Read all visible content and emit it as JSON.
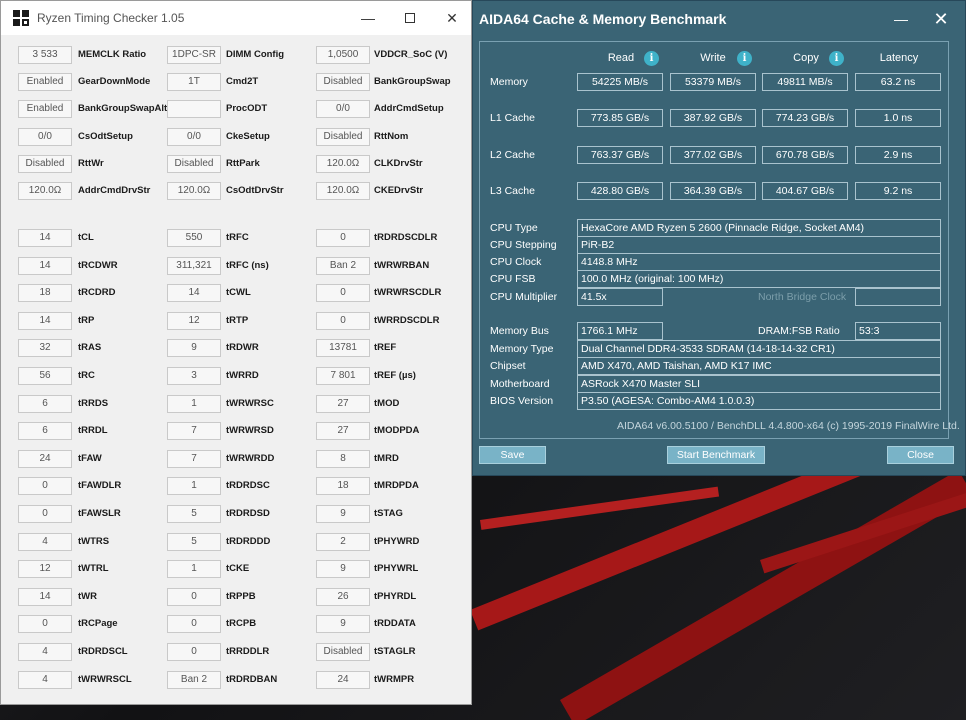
{
  "rtc": {
    "title": "Ryzen Timing Checker 1.05",
    "minimize": "—",
    "close": "✕",
    "cells": [
      {
        "label": "MEMCLK Ratio",
        "value": "3 533"
      },
      {
        "label": "DIMM Config",
        "value": "1DPC-SR"
      },
      {
        "label": "VDDCR_SoC (V)",
        "value": "1,0500"
      },
      {
        "label": "GearDownMode",
        "value": "Enabled"
      },
      {
        "label": "Cmd2T",
        "value": "1T"
      },
      {
        "label": "BankGroupSwap",
        "value": "Disabled"
      },
      {
        "label": "BankGroupSwapAlt",
        "value": "Enabled"
      },
      {
        "label": "ProcODT",
        "value": ""
      },
      {
        "label": "AddrCmdSetup",
        "value": "0/0"
      },
      {
        "label": "CsOdtSetup",
        "value": "0/0"
      },
      {
        "label": "CkeSetup",
        "value": "0/0"
      },
      {
        "label": "RttNom",
        "value": "Disabled"
      },
      {
        "label": "RttWr",
        "value": "Disabled"
      },
      {
        "label": "RttPark",
        "value": "Disabled"
      },
      {
        "label": "CLKDrvStr",
        "value": "120.0Ω"
      },
      {
        "label": "AddrCmdDrvStr",
        "value": "120.0Ω"
      },
      {
        "label": "CsOdtDrvStr",
        "value": "120.0Ω"
      },
      {
        "label": "CKEDrvStr",
        "value": "120.0Ω"
      },
      {
        "label": "tCL",
        "value": "14"
      },
      {
        "label": "tRFC",
        "value": "550"
      },
      {
        "label": "tRDRDSCDLR",
        "value": "0"
      },
      {
        "label": "tRCDWR",
        "value": "14"
      },
      {
        "label": "tRFC (ns)",
        "value": "311,321"
      },
      {
        "label": "tWRWRBAN",
        "value": "Ban 2"
      },
      {
        "label": "tRCDRD",
        "value": "18"
      },
      {
        "label": "tCWL",
        "value": "14"
      },
      {
        "label": "tWRWRSCDLR",
        "value": "0"
      },
      {
        "label": "tRP",
        "value": "14"
      },
      {
        "label": "tRTP",
        "value": "12"
      },
      {
        "label": "tWRRDSCDLR",
        "value": "0"
      },
      {
        "label": "tRAS",
        "value": "32"
      },
      {
        "label": "tRDWR",
        "value": "9"
      },
      {
        "label": "tREF",
        "value": "13781"
      },
      {
        "label": "tRC",
        "value": "56"
      },
      {
        "label": "tWRRD",
        "value": "3"
      },
      {
        "label": "tREF (µs)",
        "value": "7 801"
      },
      {
        "label": "tRRDS",
        "value": "6"
      },
      {
        "label": "tWRWRSC",
        "value": "1"
      },
      {
        "label": "tMOD",
        "value": "27"
      },
      {
        "label": "tRRDL",
        "value": "6"
      },
      {
        "label": "tWRWRSD",
        "value": "7"
      },
      {
        "label": "tMODPDA",
        "value": "27"
      },
      {
        "label": "tFAW",
        "value": "24"
      },
      {
        "label": "tWRWRDD",
        "value": "7"
      },
      {
        "label": "tMRD",
        "value": "8"
      },
      {
        "label": "tFAWDLR",
        "value": "0"
      },
      {
        "label": "tRDRDSC",
        "value": "1"
      },
      {
        "label": "tMRDPDA",
        "value": "18"
      },
      {
        "label": "tFAWSLR",
        "value": "0"
      },
      {
        "label": "tRDRDSD",
        "value": "5"
      },
      {
        "label": "tSTAG",
        "value": "9"
      },
      {
        "label": "tWTRS",
        "value": "4"
      },
      {
        "label": "tRDRDDD",
        "value": "5"
      },
      {
        "label": "tPHYWRD",
        "value": "2"
      },
      {
        "label": "tWTRL",
        "value": "12"
      },
      {
        "label": "tCKE",
        "value": "1"
      },
      {
        "label": "tPHYWRL",
        "value": "9"
      },
      {
        "label": "tWR",
        "value": "14"
      },
      {
        "label": "tRPPB",
        "value": "0"
      },
      {
        "label": "tPHYRDL",
        "value": "26"
      },
      {
        "label": "tRCPage",
        "value": "0"
      },
      {
        "label": "tRCPB",
        "value": "0"
      },
      {
        "label": "tRDDATA",
        "value": "9"
      },
      {
        "label": "tRDRDSCL",
        "value": "4"
      },
      {
        "label": "tRRDDLR",
        "value": "0"
      },
      {
        "label": "tSTAGLR",
        "value": "Disabled"
      },
      {
        "label": "tWRWRSCL",
        "value": "4"
      },
      {
        "label": "tRDRDBAN",
        "value": "Ban 2"
      },
      {
        "label": "tWRMPR",
        "value": "24"
      }
    ]
  },
  "aida": {
    "title": "AIDA64 Cache & Memory Benchmark",
    "minimize": "—",
    "close": "✕",
    "info_glyph": "i",
    "columns": [
      "Read",
      "Write",
      "Copy",
      "Latency"
    ],
    "bench_rows": [
      {
        "label": "Memory",
        "read": "54225 MB/s",
        "write": "53379 MB/s",
        "copy": "49811 MB/s",
        "latency": "63.2 ns"
      },
      {
        "label": "L1 Cache",
        "read": "773.85 GB/s",
        "write": "387.92 GB/s",
        "copy": "774.23 GB/s",
        "latency": "1.0 ns"
      },
      {
        "label": "L2 Cache",
        "read": "763.37 GB/s",
        "write": "377.02 GB/s",
        "copy": "670.78 GB/s",
        "latency": "2.9 ns"
      },
      {
        "label": "L3 Cache",
        "read": "428.80 GB/s",
        "write": "364.39 GB/s",
        "copy": "404.67 GB/s",
        "latency": "9.2 ns"
      }
    ],
    "cpu": {
      "type_label": "CPU Type",
      "type": "HexaCore AMD Ryzen 5 2600  (Pinnacle Ridge, Socket AM4)",
      "stepping_label": "CPU Stepping",
      "stepping": "PiR-B2",
      "clock_label": "CPU Clock",
      "clock": "4148.8 MHz",
      "fsb_label": "CPU FSB",
      "fsb": "100.0 MHz  (original: 100 MHz)",
      "multiplier_label": "CPU Multiplier",
      "multiplier": "41.5x",
      "nb_clock_label": "North Bridge Clock",
      "nb_clock": ""
    },
    "mem": {
      "bus_label": "Memory Bus",
      "bus": "1766.1 MHz",
      "ratio_label": "DRAM:FSB Ratio",
      "ratio": "53:3",
      "type_label": "Memory Type",
      "type": "Dual Channel DDR4-3533 SDRAM  (14-18-14-32 CR1)",
      "chipset_label": "Chipset",
      "chipset": "AMD X470, AMD Taishan, AMD K17 IMC",
      "motherboard_label": "Motherboard",
      "motherboard": "ASRock X470 Master SLI",
      "bios_label": "BIOS Version",
      "bios": "P3.50  (AGESA: Combo-AM4 1.0.0.3)"
    },
    "version": "AIDA64 v6.00.5100 / BenchDLL 4.4.800-x64  (c) 1995-2019 FinalWire Ltd.",
    "buttons": {
      "save": "Save",
      "start": "Start Benchmark",
      "close": "Close"
    }
  }
}
